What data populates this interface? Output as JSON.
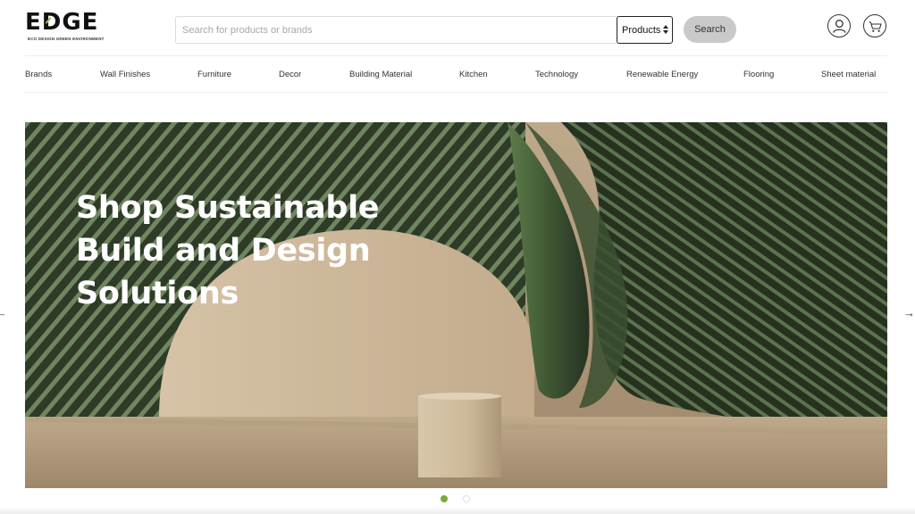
{
  "header": {
    "logo_text": "EDGE",
    "logo_tagline": "ECO DESIGN GREEN ENVIRONMENT",
    "search": {
      "placeholder": "Search for products or brands",
      "value": "",
      "category_selected": "Products",
      "button_label": "Search"
    },
    "icons": {
      "account": "user-icon",
      "cart": "cart-icon"
    }
  },
  "nav": {
    "items": [
      {
        "label": "Brands"
      },
      {
        "label": "Wall Finishes"
      },
      {
        "label": "Furniture"
      },
      {
        "label": "Decor"
      },
      {
        "label": "Building Material"
      },
      {
        "label": "Kitchen"
      },
      {
        "label": "Technology"
      },
      {
        "label": "Renewable Energy"
      },
      {
        "label": "Flooring"
      },
      {
        "label": "Sheet material"
      }
    ]
  },
  "hero": {
    "title_lines": [
      "Shop Sustainable",
      "Build and Design",
      "Solutions"
    ],
    "prev_arrow": "←",
    "next_arrow": "→",
    "slides": {
      "count": 2,
      "active": 1
    }
  },
  "colors": {
    "accent": "#7aaa3a",
    "button_gray": "#c9c9c9",
    "hero_green": "#2f3d28",
    "hero_beige": "#c3ae91"
  }
}
